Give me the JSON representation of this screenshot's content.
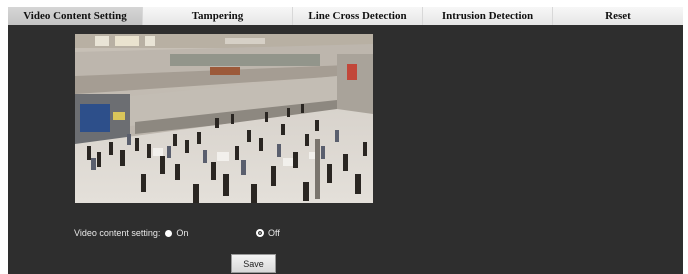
{
  "tabs": [
    {
      "label": "Video Content Setting",
      "active": true
    },
    {
      "label": "Tampering",
      "active": false
    },
    {
      "label": "Line Cross Detection",
      "active": false
    },
    {
      "label": "Intrusion Detection",
      "active": false
    },
    {
      "label": "Reset",
      "active": false
    }
  ],
  "preview": {
    "icon": "camera-preview-image"
  },
  "video_content_setting": {
    "label": "Video content setting:",
    "options": [
      {
        "label": "On",
        "selected": false
      },
      {
        "label": "Off",
        "selected": true
      }
    ]
  },
  "actions": {
    "save_label": "Save"
  },
  "colors": {
    "background": "#2e2e2e",
    "tab_bar": "#eeeeee",
    "active_tab": "#cccccc",
    "text_light": "#e8e8e8"
  }
}
